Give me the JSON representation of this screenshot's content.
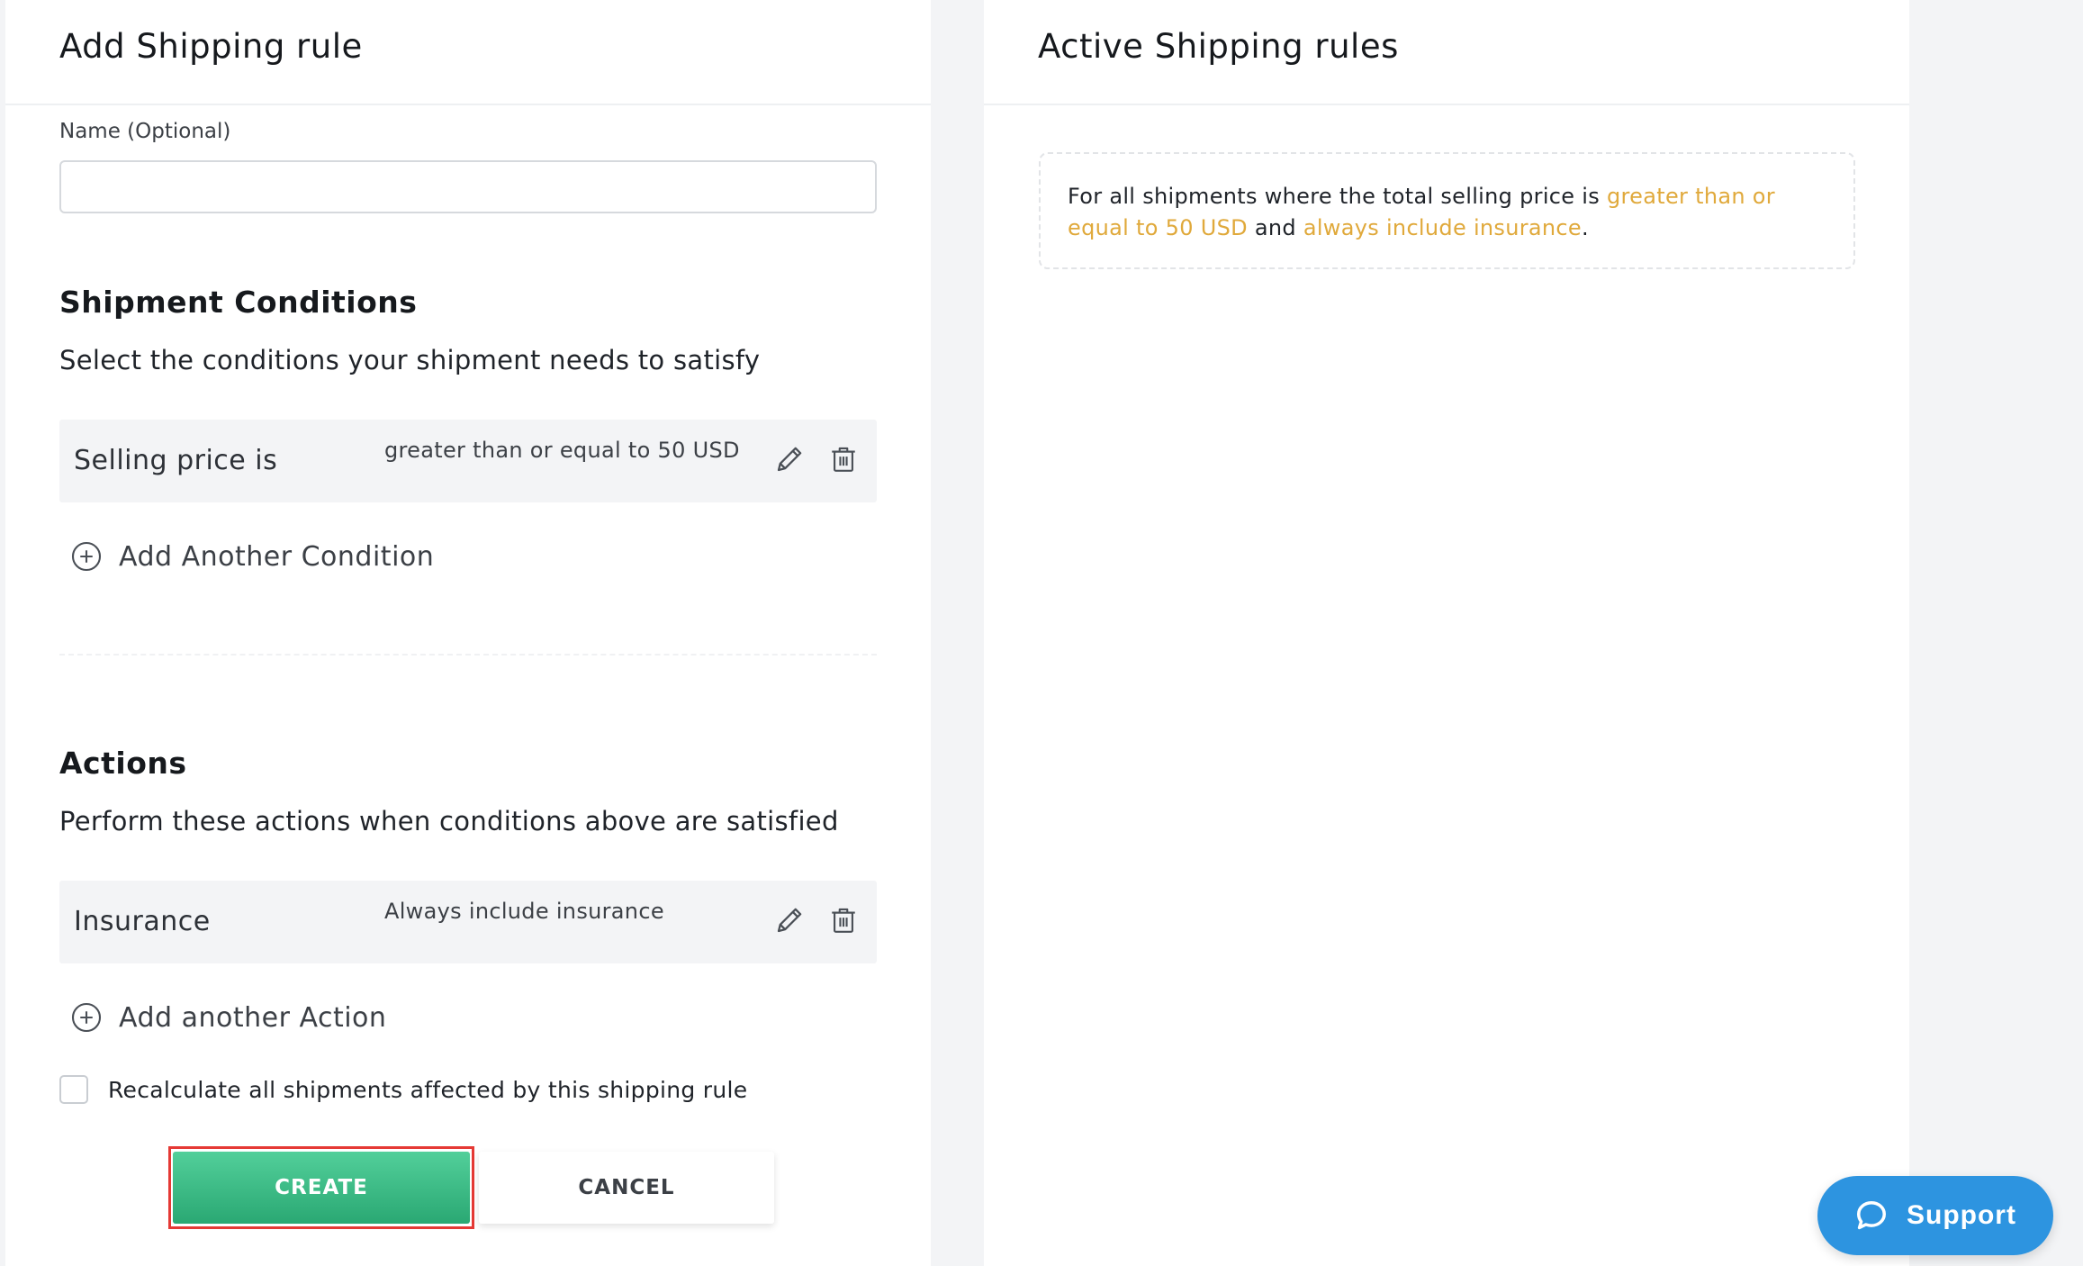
{
  "add_rule": {
    "title": "Add Shipping rule",
    "name_label": "Name (Optional)",
    "name_value": "",
    "conditions": {
      "title": "Shipment Conditions",
      "subtitle": "Select the conditions your shipment needs to satisfy",
      "items": [
        {
          "name": "Selling price is",
          "value": "greater than or equal to 50 USD"
        }
      ],
      "add_label": "Add Another Condition"
    },
    "actions": {
      "title": "Actions",
      "subtitle": "Perform these actions when conditions above are satisfied",
      "items": [
        {
          "name": "Insurance",
          "value": "Always include insurance"
        }
      ],
      "add_label": "Add another Action"
    },
    "recalculate_label": "Recalculate all shipments affected by this shipping rule",
    "recalculate_checked": false,
    "create_label": "CREATE",
    "cancel_label": "CANCEL"
  },
  "active_rules": {
    "title": "Active Shipping rules",
    "summary": {
      "prefix": "For all shipments where the total selling price is ",
      "condition": "greater than or equal to 50 USD",
      "joiner": " and ",
      "action": "always include insurance",
      "suffix": "."
    }
  },
  "support": {
    "label": "Support"
  },
  "colors": {
    "accent_green": "#2aa873",
    "highlight_orange": "#e0a93b",
    "support_blue": "#2d94e0",
    "highlight_border_red": "#e53935"
  },
  "icons": {
    "edit": "pencil-icon",
    "delete": "trash-icon",
    "add": "plus-circle-icon",
    "support": "chat-bubble-icon"
  }
}
